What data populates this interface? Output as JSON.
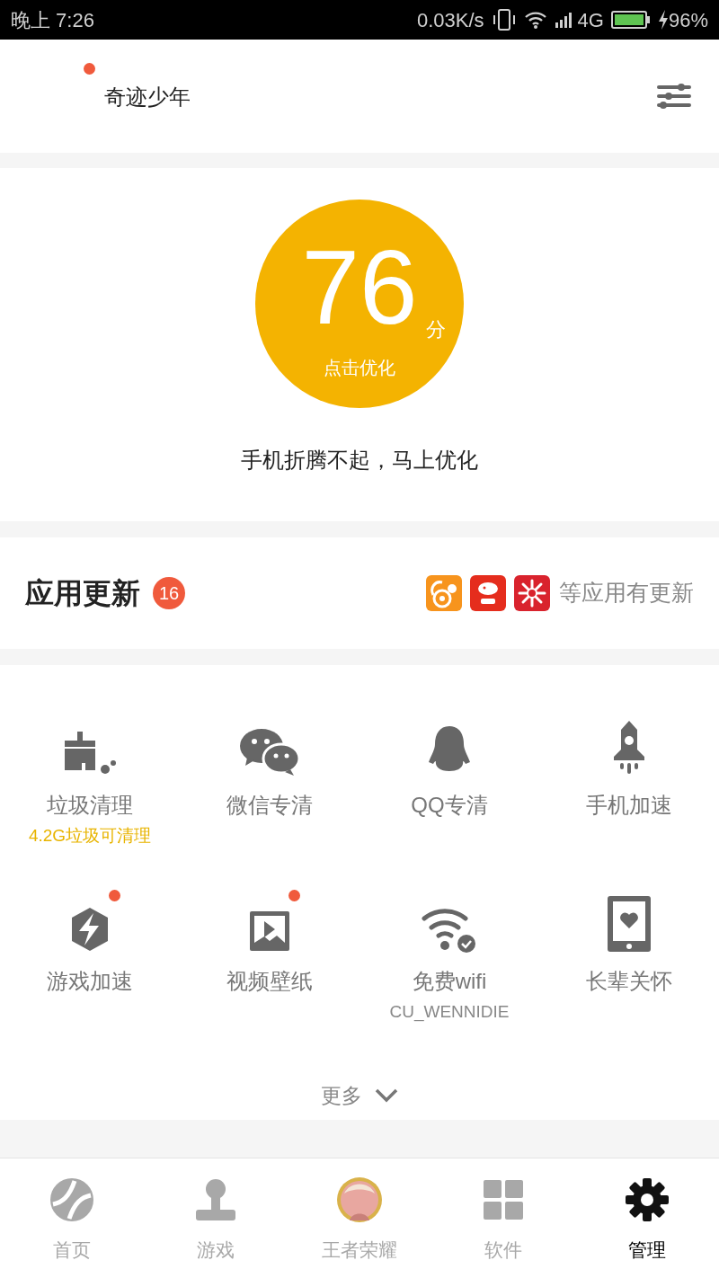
{
  "status_bar": {
    "time": "晚上 7:26",
    "net_speed": "0.03K/s",
    "network": "4G",
    "battery": "96%"
  },
  "header": {
    "title": "奇迹少年",
    "notice": true
  },
  "score": {
    "value": "76",
    "unit": "分",
    "action": "点击优化",
    "message": "手机折腾不起，马上优化"
  },
  "updates": {
    "title": "应用更新",
    "count": "16",
    "note": "等应用有更新"
  },
  "tools": [
    {
      "label": "垃圾清理",
      "sub": "4.2G垃圾可清理",
      "highlight": true,
      "dot": false
    },
    {
      "label": "微信专清",
      "dot": false
    },
    {
      "label": "QQ专清",
      "dot": false
    },
    {
      "label": "手机加速",
      "dot": false
    },
    {
      "label": "游戏加速",
      "dot": true
    },
    {
      "label": "视频壁纸",
      "dot": true
    },
    {
      "label": "免费wifi",
      "sub": "CU_WENNIDIE",
      "highlight": false,
      "dot": false
    },
    {
      "label": "长辈关怀",
      "dot": false
    }
  ],
  "more": "更多",
  "nav": [
    {
      "label": "首页",
      "selected": false
    },
    {
      "label": "游戏",
      "selected": false
    },
    {
      "label": "王者荣耀",
      "selected": false
    },
    {
      "label": "软件",
      "selected": false
    },
    {
      "label": "管理",
      "selected": true
    }
  ]
}
